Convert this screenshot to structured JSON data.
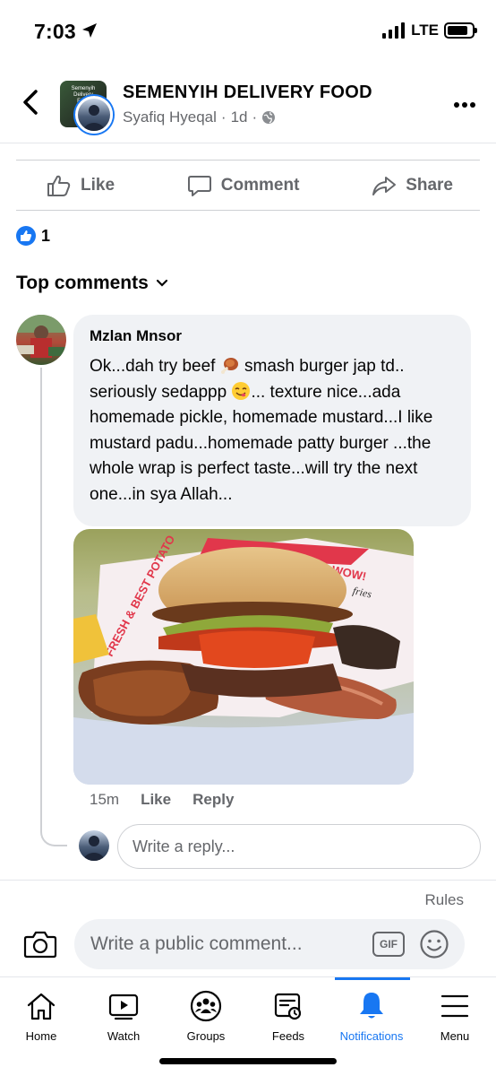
{
  "status_bar": {
    "time": "7:03",
    "network": "LTE",
    "battery_level": 0.85
  },
  "header": {
    "title": "SEMENYIH DELIVERY FOOD",
    "author": "Syafiq Hyeqal",
    "meta_time": "1d",
    "separator": "·",
    "avatar_badge": "Semenyih Delivery Food"
  },
  "actions": {
    "like": "Like",
    "comment": "Comment",
    "share": "Share"
  },
  "reactions": {
    "count": "1"
  },
  "comments_header": {
    "label": "Top comments"
  },
  "comment": {
    "author": "Mzlan Mnsor",
    "text_1": "Ok...dah try beef ",
    "text_2": " smash burger jap td..",
    "text_3": "seriously sedappp ",
    "text_4": "... texture nice...ada homemade pickle, homemade mustard...I like mustard padu...homemade patty burger ...the whole wrap is perfect taste...will try the next one...in sya Allah...",
    "time": "15m",
    "like": "Like",
    "reply": "Reply"
  },
  "photo_wrapper_text": {
    "top": "WOW!",
    "side": "FRESH & BEST POTATO",
    "right": "fries"
  },
  "reply_box": {
    "placeholder": "Write a reply..."
  },
  "composer": {
    "rules": "Rules",
    "placeholder": "Write a public comment...",
    "gif": "GIF"
  },
  "tabs": [
    {
      "label": "Home",
      "icon": "home-icon"
    },
    {
      "label": "Watch",
      "icon": "watch-icon"
    },
    {
      "label": "Groups",
      "icon": "groups-icon"
    },
    {
      "label": "Feeds",
      "icon": "feeds-icon"
    },
    {
      "label": "Notifications",
      "icon": "bell-icon",
      "active": true
    },
    {
      "label": "Menu",
      "icon": "menu-icon"
    }
  ],
  "colors": {
    "accent": "#1877f2",
    "muted_text": "#65676b",
    "bubble": "#f0f2f5"
  }
}
